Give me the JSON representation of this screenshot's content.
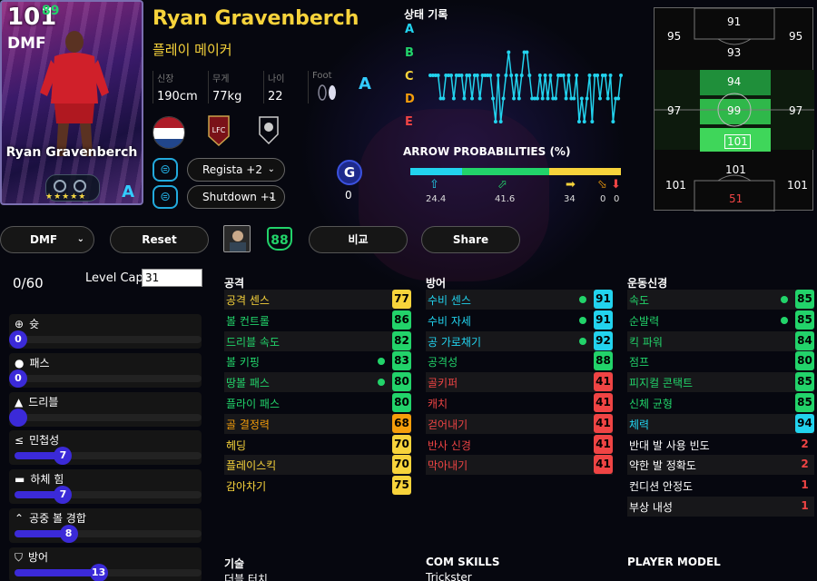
{
  "card": {
    "ovr": "101",
    "boost": "89",
    "pos": "DMF",
    "name": "Ryan Gravenberch",
    "rank": "A",
    "stars": "★★★★★"
  },
  "player": {
    "name": "Ryan Gravenberch",
    "playstyle": "플레이 메이커",
    "info": [
      {
        "label": "신장",
        "value": "190cm"
      },
      {
        "label": "무게",
        "value": "77kg"
      },
      {
        "label": "나이",
        "value": "22"
      },
      {
        "label": "Foot",
        "value": ""
      }
    ],
    "foot_rating": "A",
    "g_value": "0"
  },
  "skills_select": [
    {
      "icon": "skill-icon",
      "value": "Regista +2"
    },
    {
      "icon": "skill-icon",
      "value": "Shutdown +1"
    }
  ],
  "history": {
    "title": "상태 기록",
    "levels": [
      "A",
      "B",
      "C",
      "D",
      "E"
    ],
    "colors": [
      "#22d3ee",
      "#22d36a",
      "#f7d33b",
      "#f59e0b",
      "#ef4444"
    ],
    "values": [
      2,
      2,
      2,
      2,
      3,
      3,
      2,
      2,
      2,
      3,
      2,
      2,
      2,
      3,
      2,
      2,
      3,
      2,
      2,
      3,
      2,
      2,
      2,
      2,
      3,
      4,
      2,
      4,
      3,
      2,
      1,
      2,
      3,
      2,
      3,
      2,
      1,
      1,
      2,
      3,
      3,
      3,
      2,
      3,
      2,
      3,
      2,
      3,
      3,
      2,
      2,
      2,
      3,
      2,
      3,
      3,
      2,
      4,
      3,
      4,
      3,
      2,
      4,
      2,
      2,
      3,
      2,
      2,
      3,
      2,
      4,
      3,
      3,
      2
    ]
  },
  "arrows": {
    "title": "ARROW PROBABILITIES (%)",
    "items": [
      {
        "icon": "arrow-up-icon",
        "value": "24.4",
        "color": "#22d3ee"
      },
      {
        "icon": "arrow-diag-up-icon",
        "value": "41.6",
        "color": "#22d36a"
      },
      {
        "icon": "arrow-right-icon",
        "value": "34",
        "color": "#f7d33b"
      },
      {
        "icon": "arrow-diag-down-icon",
        "value": "0",
        "color": "#f59e0b"
      },
      {
        "icon": "arrow-down-icon",
        "value": "0",
        "color": "#ef4444"
      }
    ],
    "bar": [
      {
        "pct": 24.4,
        "color": "#22d3ee"
      },
      {
        "pct": 41.6,
        "color": "#22d36a"
      },
      {
        "pct": 34,
        "color": "#f7d33b"
      }
    ]
  },
  "field": {
    "cells": [
      "95",
      "91",
      "95",
      "93",
      "94",
      "97",
      "99",
      "97",
      "101",
      "101",
      "101",
      "101",
      "51"
    ]
  },
  "toolbar": {
    "position": "DMF",
    "reset": "Reset",
    "compare": "비교",
    "share": "Share",
    "rating": "88"
  },
  "level": {
    "points": "0/60",
    "cap_label": "Level Cap",
    "cap_value": "31"
  },
  "progression": [
    {
      "label": "슛",
      "icon": "target-icon",
      "value": "0",
      "pct": 0
    },
    {
      "label": "패스",
      "icon": "ball-icon",
      "value": "0",
      "pct": 0
    },
    {
      "label": "드리블",
      "icon": "cone-icon",
      "value": "",
      "pct": 0
    },
    {
      "label": "민첩성",
      "icon": "agility-icon",
      "value": "7",
      "pct": 24
    },
    {
      "label": "하체 힘",
      "icon": "boot-icon",
      "value": "7",
      "pct": 24
    },
    {
      "label": "공중 볼 경합",
      "icon": "chevrons-up-icon",
      "value": "8",
      "pct": 27
    },
    {
      "label": "방어",
      "icon": "shield-icon",
      "value": "13",
      "pct": 43
    }
  ],
  "stats": {
    "attack": {
      "title": "공격",
      "rows": [
        {
          "name": "공격 센스",
          "value": "77",
          "dot": false
        },
        {
          "name": "볼 컨트롤",
          "value": "86",
          "dot": false
        },
        {
          "name": "드리블 속도",
          "value": "82",
          "dot": false
        },
        {
          "name": "볼 키핑",
          "value": "83",
          "dot": true
        },
        {
          "name": "땅볼 패스",
          "value": "80",
          "dot": true
        },
        {
          "name": "플라이 패스",
          "value": "80",
          "dot": false
        },
        {
          "name": "골 결정력",
          "value": "68",
          "dot": false
        },
        {
          "name": "헤딩",
          "value": "70",
          "dot": false
        },
        {
          "name": "플레이스킥",
          "value": "70",
          "dot": false
        },
        {
          "name": "감아차기",
          "value": "75",
          "dot": false
        }
      ]
    },
    "defense": {
      "title": "방어",
      "rows": [
        {
          "name": "수비 센스",
          "value": "91",
          "dot": true
        },
        {
          "name": "수비 자세",
          "value": "91",
          "dot": true
        },
        {
          "name": "공 가로채기",
          "value": "92",
          "dot": true
        },
        {
          "name": "공격성",
          "value": "88",
          "dot": false
        },
        {
          "name": "골키퍼",
          "value": "41",
          "dot": false
        },
        {
          "name": "캐치",
          "value": "41",
          "dot": false
        },
        {
          "name": "걷어내기",
          "value": "41",
          "dot": false
        },
        {
          "name": "반사 신경",
          "value": "41",
          "dot": false
        },
        {
          "name": "막아내기",
          "value": "41",
          "dot": false
        }
      ]
    },
    "physical": {
      "title": "운동신경",
      "rows": [
        {
          "name": "속도",
          "value": "85",
          "dot": true
        },
        {
          "name": "순발력",
          "value": "85",
          "dot": true
        },
        {
          "name": "킥 파워",
          "value": "84",
          "dot": false
        },
        {
          "name": "점프",
          "value": "80",
          "dot": false
        },
        {
          "name": "피지컬 콘택트",
          "value": "85",
          "dot": false
        },
        {
          "name": "신체 균형",
          "value": "85",
          "dot": false
        },
        {
          "name": "체력",
          "value": "94",
          "dot": false
        },
        {
          "name": "반대 발 사용 빈도",
          "value": "2",
          "dot": false
        },
        {
          "name": "약한 발 정확도",
          "value": "2",
          "dot": false
        },
        {
          "name": "컨디션 안정도",
          "value": "1",
          "dot": false
        },
        {
          "name": "부상 내성",
          "value": "1",
          "dot": false
        }
      ]
    }
  },
  "sections": {
    "skills": "기술",
    "skills_first": "더블 터치",
    "com": "COM SKILLS",
    "com_first": "Trickster",
    "model": "PLAYER MODEL"
  }
}
